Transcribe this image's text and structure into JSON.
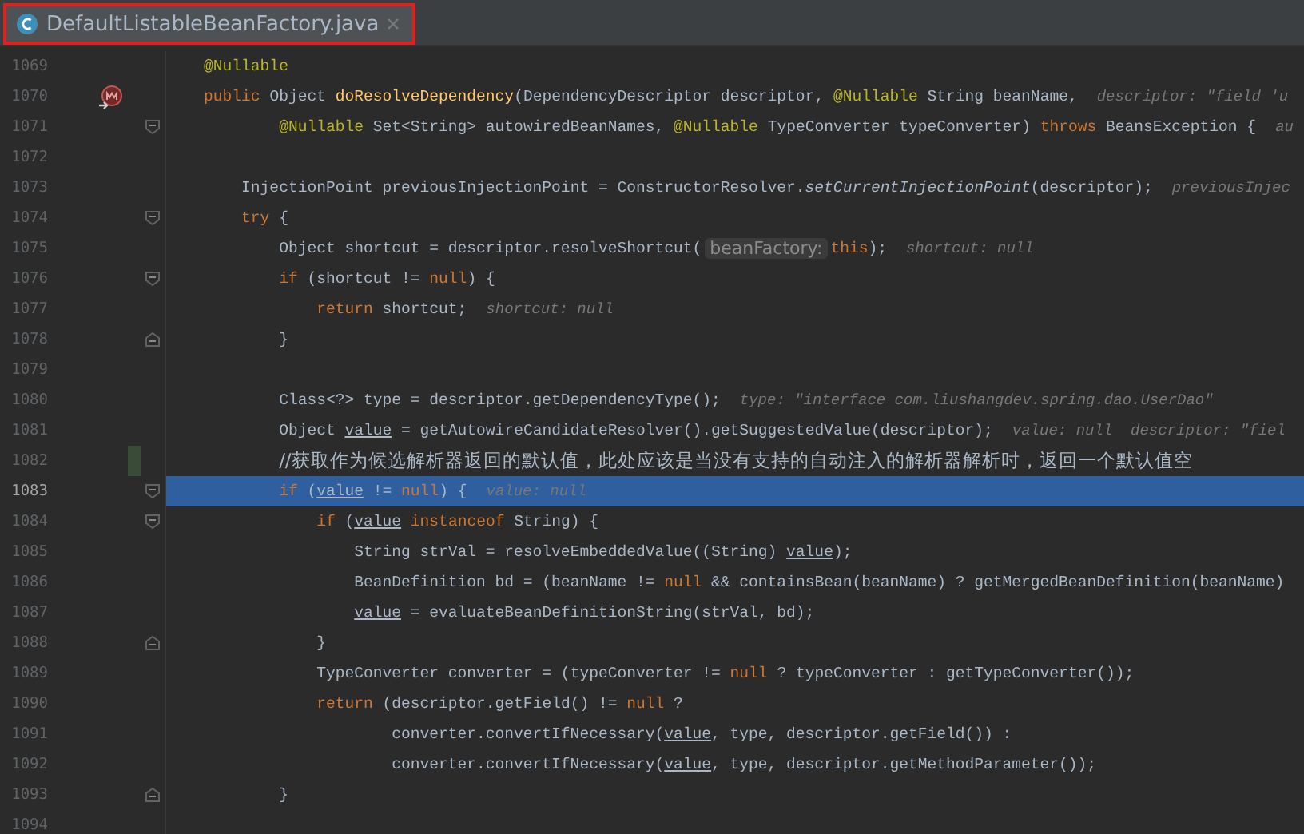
{
  "tab": {
    "title": "DefaultListableBeanFactory.java",
    "outlined": true
  },
  "lines": [
    {
      "number": "1069",
      "segments": [
        {
          "kind": "code",
          "tokens": [
            {
              "text": "    @Nullable",
              "kind": "annotation"
            }
          ]
        }
      ]
    },
    {
      "number": "1070",
      "override_marker": true,
      "segments": [
        {
          "kind": "code",
          "tokens": [
            {
              "text": "    public",
              "kind": "keyword"
            },
            {
              "text": " Object ",
              "kind": "plain"
            },
            {
              "text": "doResolveDependency",
              "kind": "declaration"
            },
            {
              "text": "(DependencyDescriptor descriptor, ",
              "kind": "plain"
            },
            {
              "text": "@Nullable",
              "kind": "annotation"
            },
            {
              "text": " String beanName,",
              "kind": "plain"
            }
          ]
        },
        {
          "kind": "hint",
          "text": "descriptor: \"field 'u"
        }
      ]
    },
    {
      "number": "1071",
      "fold_start": true,
      "segments": [
        {
          "kind": "code",
          "tokens": [
            {
              "text": "            @Nullable",
              "kind": "annotation"
            },
            {
              "text": " Set<String> autowiredBeanNames, ",
              "kind": "plain"
            },
            {
              "text": "@Nullable",
              "kind": "annotation"
            },
            {
              "text": " TypeConverter typeConverter) ",
              "kind": "plain"
            },
            {
              "text": "throws",
              "kind": "keyword"
            },
            {
              "text": " BeansException {",
              "kind": "plain"
            }
          ]
        },
        {
          "kind": "hint",
          "text": "au"
        }
      ]
    },
    {
      "number": "1072"
    },
    {
      "number": "1073",
      "segments": [
        {
          "kind": "code",
          "tokens": [
            {
              "text": "        InjectionPoint previousInjectionPoint = ConstructorResolver.",
              "kind": "plain"
            },
            {
              "text": "setCurrentInjectionPoint",
              "kind": "static"
            },
            {
              "text": "(descriptor);",
              "kind": "plain"
            }
          ]
        },
        {
          "kind": "hint",
          "text": "previousInjec"
        }
      ]
    },
    {
      "number": "1074",
      "fold_start": true,
      "segments": [
        {
          "kind": "code",
          "tokens": [
            {
              "text": "        try",
              "kind": "keyword"
            },
            {
              "text": " {",
              "kind": "plain"
            }
          ]
        }
      ]
    },
    {
      "number": "1075",
      "segments": [
        {
          "kind": "code",
          "tokens": [
            {
              "text": "            Object shortcut = descriptor.resolveShortcut(",
              "kind": "plain"
            }
          ]
        },
        {
          "kind": "param_hint",
          "text": "beanFactory:"
        },
        {
          "kind": "code",
          "tokens": [
            {
              "text": "this",
              "kind": "keyword"
            },
            {
              "text": ");",
              "kind": "plain"
            }
          ]
        },
        {
          "kind": "hint",
          "text": "shortcut: null"
        }
      ]
    },
    {
      "number": "1076",
      "fold_start": true,
      "segments": [
        {
          "kind": "code",
          "tokens": [
            {
              "text": "            if",
              "kind": "keyword"
            },
            {
              "text": " (shortcut != ",
              "kind": "plain"
            },
            {
              "text": "null",
              "kind": "keyword"
            },
            {
              "text": ") {",
              "kind": "plain"
            }
          ]
        }
      ]
    },
    {
      "number": "1077",
      "segments": [
        {
          "kind": "code",
          "tokens": [
            {
              "text": "                return",
              "kind": "keyword"
            },
            {
              "text": " shortcut;",
              "kind": "plain"
            }
          ]
        },
        {
          "kind": "hint",
          "text": "shortcut: null"
        }
      ]
    },
    {
      "number": "1078",
      "fold_end": true,
      "segments": [
        {
          "kind": "code",
          "tokens": [
            {
              "text": "            }",
              "kind": "plain"
            }
          ]
        }
      ]
    },
    {
      "number": "1079"
    },
    {
      "number": "1080",
      "segments": [
        {
          "kind": "code",
          "tokens": [
            {
              "text": "            Class<?> type = descriptor.getDependencyType();",
              "kind": "plain"
            }
          ]
        },
        {
          "kind": "hint",
          "text": "type: \"interface com.liushangdev.spring.dao.UserDao\""
        }
      ]
    },
    {
      "number": "1081",
      "segments": [
        {
          "kind": "code",
          "tokens": [
            {
              "text": "            Object ",
              "kind": "plain"
            },
            {
              "text": "value",
              "kind": "underlined"
            },
            {
              "text": " = getAutowireCandidateResolver().getSuggestedValue(descriptor);",
              "kind": "plain"
            }
          ]
        },
        {
          "kind": "hint",
          "text": "value: null  descriptor: \"fiel"
        }
      ]
    },
    {
      "number": "1082",
      "changed": true,
      "segments": [
        {
          "kind": "code",
          "tokens": [
            {
              "text": "            //获取作为候选解析器返回的默认值，此处应该是当没有支持的自动注入的解析器解析时，返回一个默认值空",
              "kind": "comment"
            }
          ]
        }
      ]
    },
    {
      "number": "1083",
      "fold_start": true,
      "selected": true,
      "segments": [
        {
          "kind": "code",
          "tokens": [
            {
              "text": "            if",
              "kind": "keyword"
            },
            {
              "text": " (",
              "kind": "plain"
            },
            {
              "text": "value",
              "kind": "underlined"
            },
            {
              "text": " != ",
              "kind": "plain"
            },
            {
              "text": "null",
              "kind": "keyword"
            },
            {
              "text": ") {",
              "kind": "plain"
            }
          ]
        },
        {
          "kind": "hint",
          "text": "value: null"
        }
      ]
    },
    {
      "number": "1084",
      "fold_start": true,
      "segments": [
        {
          "kind": "code",
          "tokens": [
            {
              "text": "                if",
              "kind": "keyword"
            },
            {
              "text": " (",
              "kind": "plain"
            },
            {
              "text": "value",
              "kind": "underlined"
            },
            {
              "text": " instanceof",
              "kind": "keyword"
            },
            {
              "text": " String) {",
              "kind": "plain"
            }
          ]
        }
      ]
    },
    {
      "number": "1085",
      "segments": [
        {
          "kind": "code",
          "tokens": [
            {
              "text": "                    String strVal = resolveEmbeddedValue((String) ",
              "kind": "plain"
            },
            {
              "text": "value",
              "kind": "underlined"
            },
            {
              "text": ");",
              "kind": "plain"
            }
          ]
        }
      ]
    },
    {
      "number": "1086",
      "segments": [
        {
          "kind": "code",
          "tokens": [
            {
              "text": "                    BeanDefinition bd = (beanName != ",
              "kind": "plain"
            },
            {
              "text": "null",
              "kind": "keyword"
            },
            {
              "text": " && containsBean(beanName) ? getMergedBeanDefinition(beanName)",
              "kind": "plain"
            }
          ]
        }
      ]
    },
    {
      "number": "1087",
      "segments": [
        {
          "kind": "code",
          "tokens": [
            {
              "text": "                    value",
              "kind": "underlined"
            },
            {
              "text": " = evaluateBeanDefinitionString(strVal, bd);",
              "kind": "plain"
            }
          ]
        }
      ]
    },
    {
      "number": "1088",
      "fold_end": true,
      "segments": [
        {
          "kind": "code",
          "tokens": [
            {
              "text": "                }",
              "kind": "plain"
            }
          ]
        }
      ]
    },
    {
      "number": "1089",
      "segments": [
        {
          "kind": "code",
          "tokens": [
            {
              "text": "                TypeConverter converter = (typeConverter != ",
              "kind": "plain"
            },
            {
              "text": "null",
              "kind": "keyword"
            },
            {
              "text": " ? typeConverter : getTypeConverter());",
              "kind": "plain"
            }
          ]
        }
      ]
    },
    {
      "number": "1090",
      "segments": [
        {
          "kind": "code",
          "tokens": [
            {
              "text": "                return",
              "kind": "keyword"
            },
            {
              "text": " (descriptor.getField() != ",
              "kind": "plain"
            },
            {
              "text": "null",
              "kind": "keyword"
            },
            {
              "text": " ?",
              "kind": "plain"
            }
          ]
        }
      ]
    },
    {
      "number": "1091",
      "segments": [
        {
          "kind": "code",
          "tokens": [
            {
              "text": "                        converter.convertIfNecessary(",
              "kind": "plain"
            },
            {
              "text": "value",
              "kind": "underlined"
            },
            {
              "text": ", type, descriptor.getField()) :",
              "kind": "plain"
            }
          ]
        }
      ]
    },
    {
      "number": "1092",
      "segments": [
        {
          "kind": "code",
          "tokens": [
            {
              "text": "                        converter.convertIfNecessary(",
              "kind": "plain"
            },
            {
              "text": "value",
              "kind": "underlined"
            },
            {
              "text": ", type, descriptor.getMethodParameter());",
              "kind": "plain"
            }
          ]
        }
      ]
    },
    {
      "number": "1093",
      "fold_end": true,
      "segments": [
        {
          "kind": "code",
          "tokens": [
            {
              "text": "            }",
              "kind": "plain"
            }
          ]
        }
      ]
    },
    {
      "number": "1094"
    }
  ]
}
